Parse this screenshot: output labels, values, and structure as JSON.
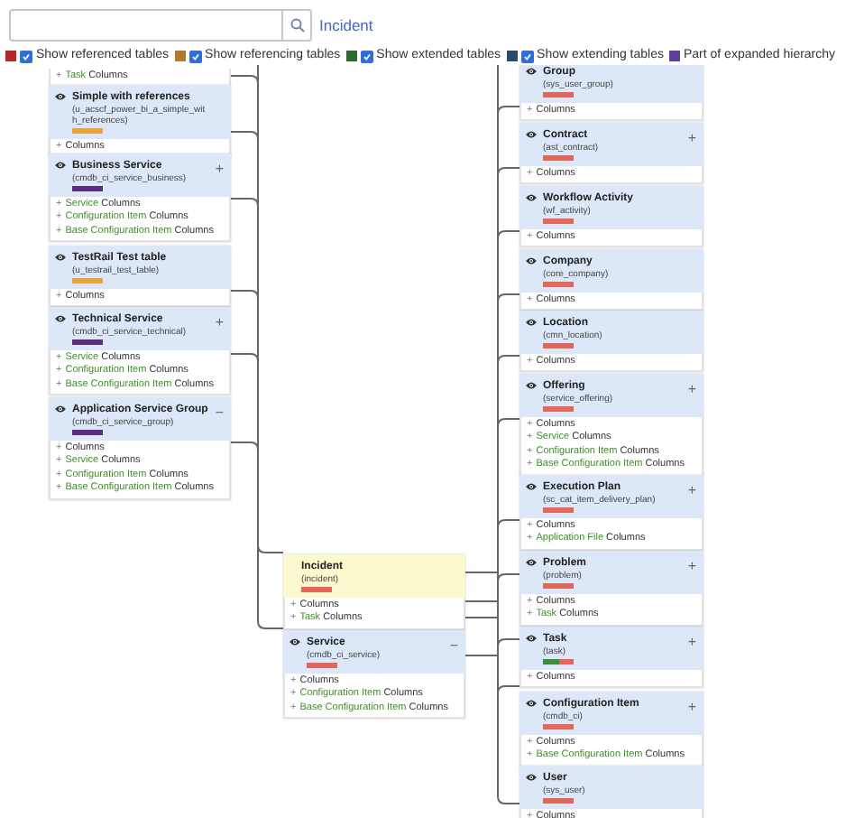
{
  "search": {
    "link": "Incident"
  },
  "legend": [
    {
      "kind": "checkbox",
      "color": "#b5272d",
      "checked": true,
      "label": "Show referenced tables"
    },
    {
      "kind": "checkbox",
      "color": "#b07a2a",
      "checked": true,
      "label": "Show referencing tables"
    },
    {
      "kind": "checkbox",
      "color": "#2f6b2f",
      "checked": true,
      "label": "Show extended tables"
    },
    {
      "kind": "checkbox",
      "color": "#2c4a6e",
      "checked": true,
      "label": "Show extending tables"
    },
    {
      "kind": "swatch",
      "color": "#5e3f99",
      "label": "Part of expanded hierarchy"
    }
  ],
  "left_tables": [
    {
      "kind": "rows_only",
      "rows": [
        {
          "marker": "+",
          "table": "Task",
          "label": "Columns"
        }
      ]
    },
    {
      "kind": "table",
      "title": "Simple with references",
      "name": "(u_acscf_power_bi_a_simple_with_references)",
      "bars": [
        {
          "color": "#e8a33c"
        }
      ],
      "rows": [
        {
          "marker": "+",
          "label": "Columns"
        }
      ]
    },
    {
      "kind": "table",
      "title": "Business Service",
      "name": "(cmdb_ci_service_business)",
      "bars": [
        {
          "color": "#5b2d82"
        }
      ],
      "toggle": "+",
      "rows": [
        {
          "marker": "+",
          "table": "Service",
          "label": "Columns"
        },
        {
          "marker": "+",
          "table": "Configuration Item",
          "label": "Columns"
        },
        {
          "marker": "+",
          "table": "Base Configuration Item",
          "label": "Columns"
        }
      ]
    },
    {
      "kind": "table",
      "title": "TestRail Test table",
      "name": "(u_testrail_test_table)",
      "bars": [
        {
          "color": "#e8a33c"
        }
      ],
      "rows": [
        {
          "marker": "+",
          "label": "Columns"
        }
      ]
    },
    {
      "kind": "table",
      "title": "Technical Service",
      "name": "(cmdb_ci_service_technical)",
      "bars": [
        {
          "color": "#5b2d82"
        }
      ],
      "toggle": "+",
      "rows": [
        {
          "marker": "+",
          "table": "Service",
          "label": "Columns"
        },
        {
          "marker": "+",
          "table": "Configuration Item",
          "label": "Columns"
        },
        {
          "marker": "+",
          "table": "Base Configuration Item",
          "label": "Columns"
        }
      ]
    },
    {
      "kind": "table",
      "title": "Application Service Group",
      "name": "(cmdb_ci_service_group)",
      "bars": [
        {
          "color": "#5b2d82"
        }
      ],
      "toggle": "−",
      "rows": [
        {
          "marker": "+",
          "label": "Columns"
        },
        {
          "marker": "+",
          "table": "Service",
          "label": "Columns"
        },
        {
          "marker": "+",
          "table": "Configuration Item",
          "label": "Columns"
        },
        {
          "marker": "+",
          "table": "Base Configuration Item",
          "label": "Columns"
        }
      ]
    }
  ],
  "center_tables": [
    {
      "kind": "focus",
      "title": "Incident",
      "name": "(incident)",
      "bars": [
        {
          "color": "#e0675a"
        }
      ],
      "rows": [
        {
          "marker": "+",
          "label": "Columns"
        },
        {
          "marker": "+",
          "table": "Task",
          "label": "Columns"
        }
      ]
    },
    {
      "kind": "table",
      "title": "Service",
      "name": "(cmdb_ci_service)",
      "bars": [
        {
          "color": "#e0675a"
        }
      ],
      "toggle": "−",
      "rows": [
        {
          "marker": "+",
          "label": "Columns"
        },
        {
          "marker": "+",
          "table": "Configuration Item",
          "label": "Columns"
        },
        {
          "marker": "+",
          "table": "Base Configuration Item",
          "label": "Columns"
        }
      ]
    }
  ],
  "right_tables": [
    {
      "kind": "table",
      "title": "Group",
      "name": "(sys_user_group)",
      "bars": [
        {
          "color": "#e0675a"
        }
      ],
      "rows": [
        {
          "marker": "+",
          "label": "Columns"
        }
      ]
    },
    {
      "kind": "table",
      "title": "Contract",
      "name": "(ast_contract)",
      "bars": [
        {
          "color": "#e0675a"
        }
      ],
      "toggle": "+",
      "rows": [
        {
          "marker": "+",
          "label": "Columns"
        }
      ]
    },
    {
      "kind": "table",
      "title": "Workflow Activity",
      "name": "(wf_activity)",
      "bars": [
        {
          "color": "#e0675a"
        }
      ],
      "rows": [
        {
          "marker": "+",
          "label": "Columns"
        }
      ]
    },
    {
      "kind": "table",
      "title": "Company",
      "name": "(core_company)",
      "bars": [
        {
          "color": "#e0675a"
        }
      ],
      "rows": [
        {
          "marker": "+",
          "label": "Columns"
        }
      ]
    },
    {
      "kind": "table",
      "title": "Location",
      "name": "(cmn_location)",
      "bars": [
        {
          "color": "#e0675a"
        }
      ],
      "rows": [
        {
          "marker": "+",
          "label": "Columns"
        }
      ]
    },
    {
      "kind": "table",
      "title": "Offering",
      "name": "(service_offering)",
      "bars": [
        {
          "color": "#e0675a"
        }
      ],
      "toggle": "+",
      "rows": [
        {
          "marker": "+",
          "label": "Columns"
        },
        {
          "marker": "+",
          "table": "Service",
          "label": "Columns"
        },
        {
          "marker": "+",
          "table": "Configuration Item",
          "label": "Columns"
        },
        {
          "marker": "+",
          "table": "Base Configuration Item",
          "label": "Columns"
        }
      ]
    },
    {
      "kind": "table",
      "title": "Execution Plan",
      "name": "(sc_cat_item_delivery_plan)",
      "bars": [
        {
          "color": "#e0675a"
        }
      ],
      "toggle": "+",
      "rows": [
        {
          "marker": "+",
          "label": "Columns"
        },
        {
          "marker": "+",
          "table": "Application File",
          "label": "Columns"
        }
      ]
    },
    {
      "kind": "table",
      "title": "Problem",
      "name": "(problem)",
      "bars": [
        {
          "color": "#e0675a"
        }
      ],
      "toggle": "+",
      "rows": [
        {
          "marker": "+",
          "label": "Columns"
        },
        {
          "marker": "+",
          "table": "Task",
          "label": "Columns"
        }
      ]
    },
    {
      "kind": "table",
      "title": "Task",
      "name": "(task)",
      "bars": [
        {
          "color": "#3c8c3c"
        },
        {
          "color": "#e0675a"
        }
      ],
      "toggle": "+",
      "rows": [
        {
          "marker": "+",
          "label": "Columns"
        }
      ]
    },
    {
      "kind": "table",
      "title": "Configuration Item",
      "name": "(cmdb_ci)",
      "bars": [
        {
          "color": "#e0675a"
        }
      ],
      "toggle": "+",
      "rows": [
        {
          "marker": "+",
          "label": "Columns"
        },
        {
          "marker": "+",
          "table": "Base Configuration Item",
          "label": "Columns"
        }
      ]
    },
    {
      "kind": "table",
      "title": "User",
      "name": "(sys_user)",
      "bars": [
        {
          "color": "#e0675a"
        }
      ],
      "rows": [
        {
          "marker": "+",
          "label": "Columns"
        }
      ]
    }
  ]
}
